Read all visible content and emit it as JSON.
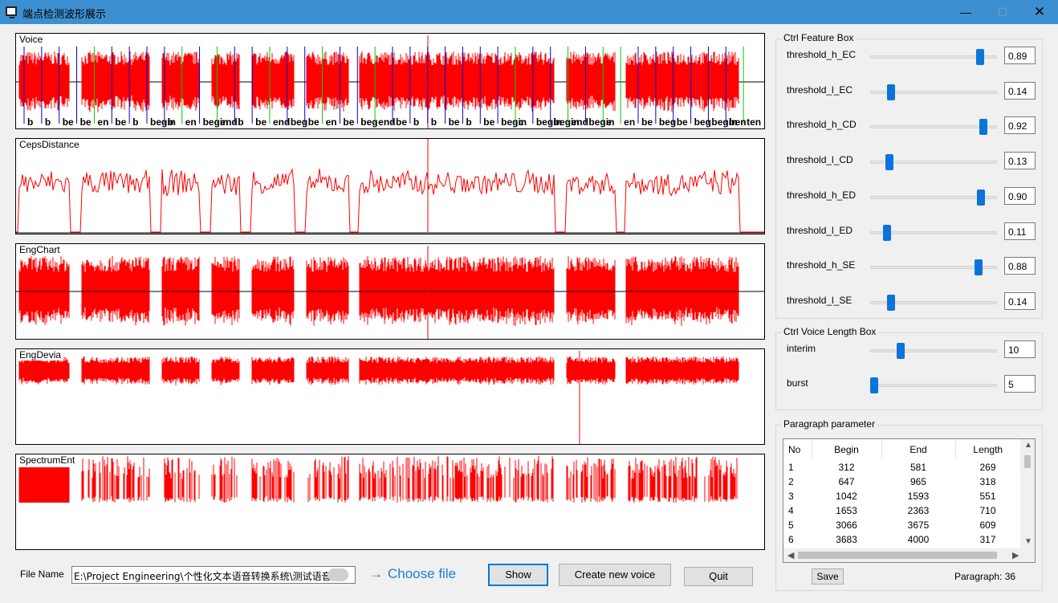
{
  "window": {
    "title": "端点检测波形展示",
    "minimize_glyph": "—",
    "maximize_glyph": "☐",
    "close_glyph": "✕"
  },
  "plots": [
    {
      "label": "Voice"
    },
    {
      "label": "CepsDistance"
    },
    {
      "label": "EngChart"
    },
    {
      "label": "EngDevia"
    },
    {
      "label": "SpectrumEnt"
    }
  ],
  "voice_markers": [
    "b",
    "b",
    "be",
    "be",
    "en",
    "be",
    "b",
    "begin",
    "b",
    "en",
    "begin",
    "end",
    "b",
    "be",
    "end",
    "beg",
    "be",
    "en",
    "be",
    "beg",
    "end",
    "be",
    "b",
    "b",
    "be",
    "b",
    "be",
    "begin",
    "c",
    "begin",
    "begin",
    "end",
    "begin",
    "e",
    "en",
    "be",
    "beg",
    "be",
    "beg",
    "begin",
    "ben",
    "ten"
  ],
  "feature_box": {
    "title": "Ctrl Feature Box",
    "sliders": [
      {
        "label": "threshold_h_EC",
        "value": "0.89",
        "level": 0.89
      },
      {
        "label": "threshold_l_EC",
        "value": "0.14",
        "level": 0.14
      },
      {
        "label": "threshold_h_CD",
        "value": "0.92",
        "level": 0.92
      },
      {
        "label": "threshold_l_CD",
        "value": "0.13",
        "level": 0.13
      },
      {
        "label": "threshold_h_ED",
        "value": "0.90",
        "level": 0.9
      },
      {
        "label": "threshold_l_ED",
        "value": "0.11",
        "level": 0.11
      },
      {
        "label": "threshold_h_SE",
        "value": "0.88",
        "level": 0.88
      },
      {
        "label": "threshold_l_SE",
        "value": "0.14",
        "level": 0.14
      }
    ]
  },
  "voice_length_box": {
    "title": "Ctrl Voice Length Box",
    "sliders": [
      {
        "label": "interim",
        "value": "10",
        "level": 0.22
      },
      {
        "label": "burst",
        "value": "5",
        "level": 0.0
      }
    ]
  },
  "paragraph": {
    "title": "Paragraph parameter",
    "columns": [
      "No",
      "Begin",
      "End",
      "Length"
    ],
    "rows": [
      [
        "1",
        "312",
        "581",
        "269"
      ],
      [
        "2",
        "647",
        "965",
        "318"
      ],
      [
        "3",
        "1042",
        "1593",
        "551"
      ],
      [
        "4",
        "1653",
        "2363",
        "710"
      ],
      [
        "5",
        "3066",
        "3675",
        "609"
      ],
      [
        "6",
        "3683",
        "4000",
        "317"
      ]
    ],
    "save_label": "Save",
    "count_text": "Paragraph: 36"
  },
  "file": {
    "label": "File Name",
    "path": "E:\\Project Engineering\\个性化文本语音转换系统\\测试语音\\",
    "choose_label": "Choose file",
    "choose_arrow": "→"
  },
  "buttons": {
    "show": "Show",
    "create": "Create new voice",
    "quit": "Quit"
  },
  "colors": {
    "signal": "#ff0000",
    "titlebar": "#3c8fd0",
    "accent": "#0a74da",
    "begin_marker": "#0000cc",
    "end_marker": "#00cc00"
  }
}
